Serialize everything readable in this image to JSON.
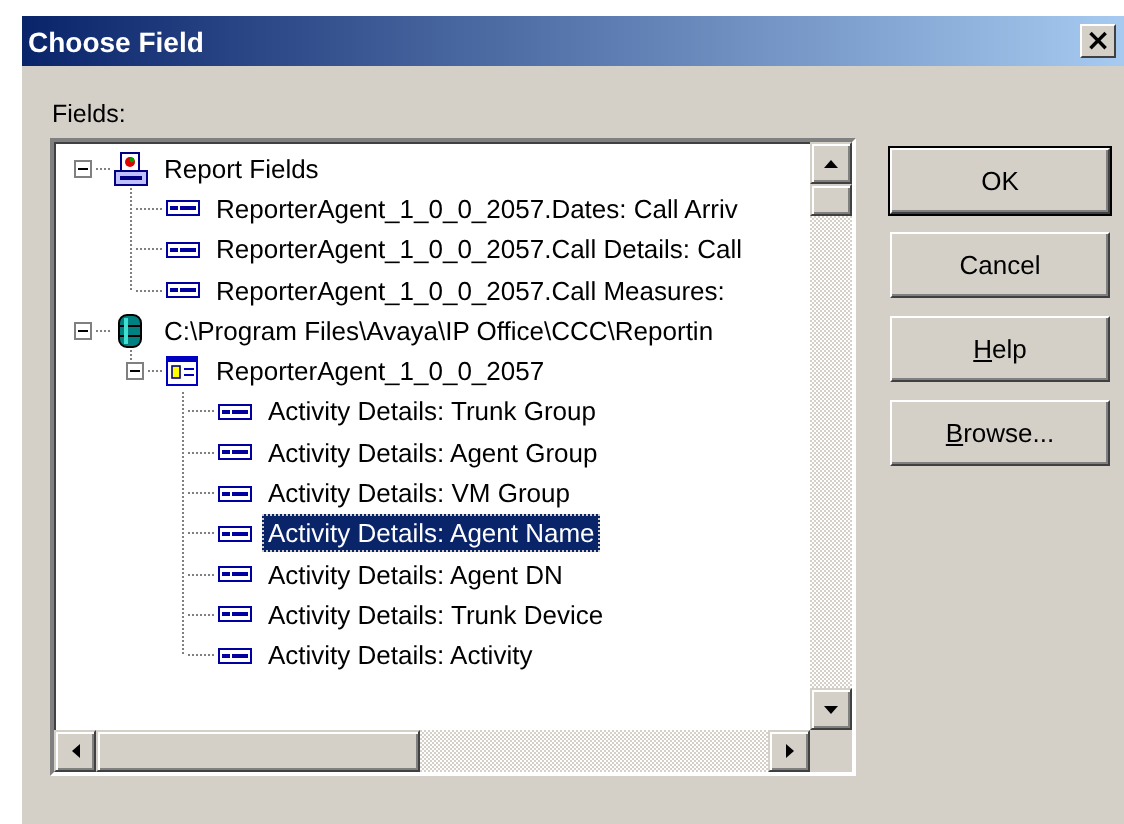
{
  "window": {
    "title": "Choose Field",
    "close": "×"
  },
  "fields_label": "Fields:",
  "tree": [
    {
      "label": "Report Fields",
      "kind": "report",
      "expanded": true,
      "selected": false,
      "children": [
        {
          "label": "ReporterAgent_1_0_0_2057.Dates: Call Arriv",
          "kind": "field",
          "selected": false
        },
        {
          "label": "ReporterAgent_1_0_0_2057.Call Details: Call",
          "kind": "field",
          "selected": false
        },
        {
          "label": "ReporterAgent_1_0_0_2057.Call Measures:",
          "kind": "field",
          "selected": false
        }
      ]
    },
    {
      "label": "C:\\Program Files\\Avaya\\IP Office\\CCC\\Reportin",
      "kind": "database",
      "expanded": true,
      "selected": false,
      "children": [
        {
          "label": "ReporterAgent_1_0_0_2057",
          "kind": "table",
          "expanded": true,
          "selected": false,
          "children": [
            {
              "label": "Activity Details: Trunk Group",
              "kind": "field",
              "selected": false
            },
            {
              "label": "Activity Details: Agent Group",
              "kind": "field",
              "selected": false
            },
            {
              "label": "Activity Details: VM Group",
              "kind": "field",
              "selected": false
            },
            {
              "label": "Activity Details: Agent Name",
              "kind": "field",
              "selected": true
            },
            {
              "label": "Activity Details: Agent DN",
              "kind": "field",
              "selected": false
            },
            {
              "label": "Activity Details: Trunk Device",
              "kind": "field",
              "selected": false
            },
            {
              "label": "Activity Details: Activity",
              "kind": "field",
              "selected": false
            }
          ]
        }
      ]
    }
  ],
  "buttons": [
    {
      "label": "OK",
      "kind": "default"
    },
    {
      "label": "Cancel",
      "kind": "normal"
    },
    {
      "label": "Help",
      "kind": "normal",
      "access_key_underlined": true
    },
    {
      "label": "Browse...",
      "kind": "normal",
      "access_key_underlined": true
    }
  ]
}
